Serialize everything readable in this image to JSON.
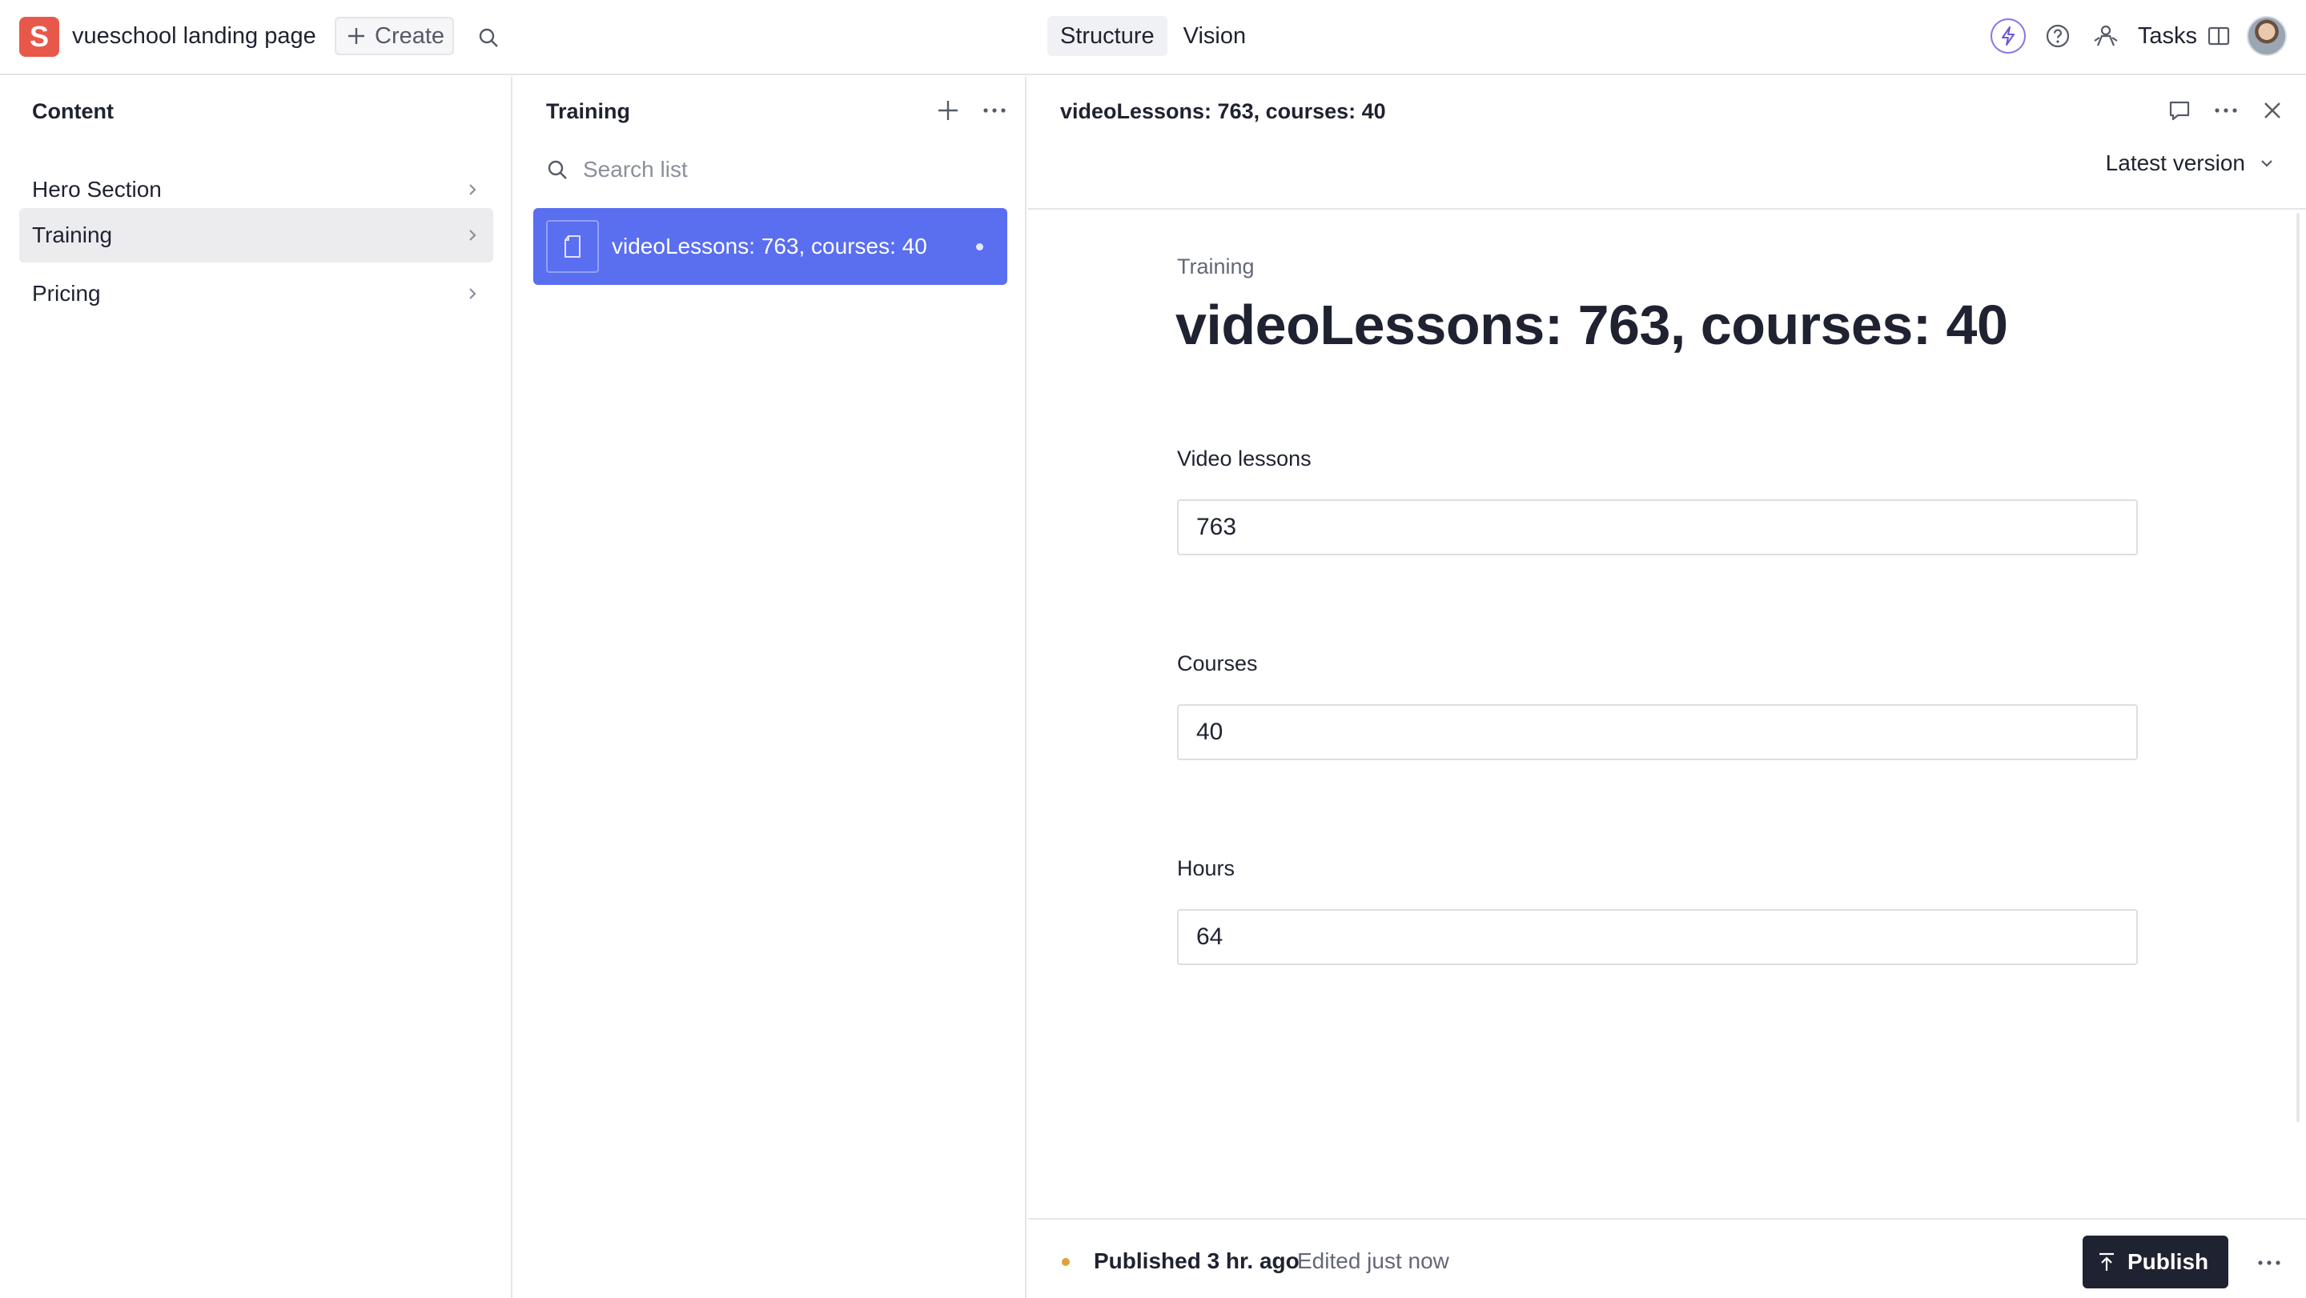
{
  "topbar": {
    "logo_letter": "S",
    "project_title": "vueschool landing page",
    "create_label": "Create",
    "tabs": [
      {
        "label": "Structure",
        "active": true
      },
      {
        "label": "Vision",
        "active": false
      }
    ],
    "tasks_label": "Tasks",
    "icons": [
      "bolt-icon",
      "help-icon",
      "community-icon",
      "panel-icon"
    ]
  },
  "content_pane": {
    "title": "Content",
    "items": [
      {
        "label": "Hero Section",
        "active": false
      },
      {
        "label": "Training",
        "active": true
      },
      {
        "label": "Pricing",
        "active": false
      }
    ]
  },
  "list_pane": {
    "title": "Training",
    "search_placeholder": "Search list",
    "items": [
      {
        "label": "videoLessons: 763, courses: 40",
        "selected": true
      }
    ]
  },
  "document": {
    "header_title": "videoLessons: 763, courses: 40",
    "version_label": "Latest version",
    "type_label": "Training",
    "title": "videoLessons: 763, courses: 40",
    "fields": [
      {
        "label": "Video lessons",
        "value": "763"
      },
      {
        "label": "Courses",
        "value": "40"
      },
      {
        "label": "Hours",
        "value": "64"
      }
    ],
    "footer": {
      "published": "Published 3 hr. ago",
      "edited": "Edited just now",
      "publish_label": "Publish"
    }
  },
  "colors": {
    "accent": "#5a6ef0",
    "logo": "#e8584a",
    "status_dot": "#e2a13a",
    "publish_bg": "#1f2230"
  }
}
